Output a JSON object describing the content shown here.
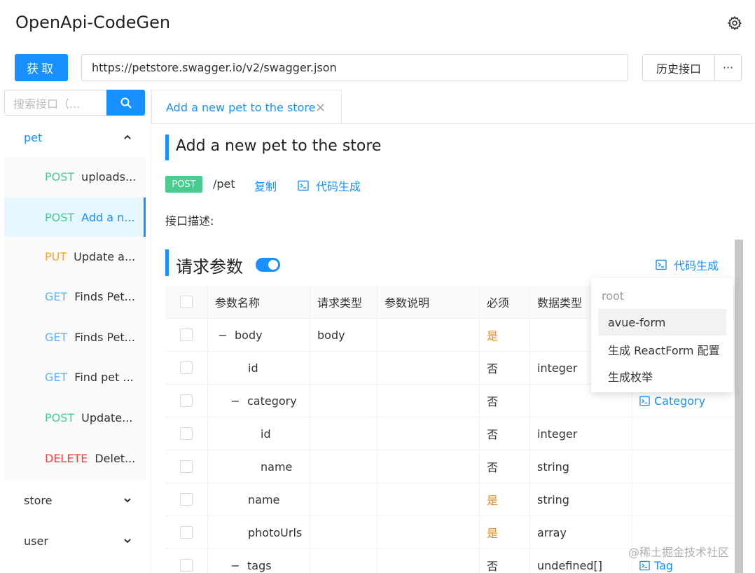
{
  "app": {
    "title": "OpenApi-CodeGen"
  },
  "toolbar": {
    "fetch_label": "获取",
    "url_value": "https://petstore.swagger.io/v2/swagger.json",
    "history_label": "历史接口",
    "more_label": "···"
  },
  "sidebar": {
    "search_placeholder": "搜索接口（...",
    "groups": [
      {
        "label": "pet",
        "expanded": true,
        "items": [
          {
            "method": "POST",
            "label": "uploads..."
          },
          {
            "method": "POST",
            "label": "Add a n...",
            "active": true
          },
          {
            "method": "PUT",
            "label": "Update a..."
          },
          {
            "method": "GET",
            "label": "Finds Pet..."
          },
          {
            "method": "GET",
            "label": "Finds Pet..."
          },
          {
            "method": "GET",
            "label": "Find pet ..."
          },
          {
            "method": "POST",
            "label": "Update..."
          },
          {
            "method": "DELETE",
            "label": "Delet..."
          }
        ]
      },
      {
        "label": "store",
        "expanded": false
      },
      {
        "label": "user",
        "expanded": false
      }
    ]
  },
  "tab": {
    "label": "Add a new pet to the store",
    "close": "×"
  },
  "operation": {
    "title": "Add a new pet to the store",
    "method": "POST",
    "path": "/pet",
    "copy_label": "复制",
    "codegen_label": "代码生成",
    "description_label": "接口描述:"
  },
  "params": {
    "section_title": "请求参数",
    "toggle_on": true,
    "codegen_label": "代码生成",
    "columns": [
      "参数名称",
      "请求类型",
      "参数说明",
      "必须",
      "数据类型"
    ],
    "rows": [
      {
        "name": "body",
        "in": "body",
        "desc": "",
        "required": "是",
        "type": "",
        "indent": 0,
        "expander": "−"
      },
      {
        "name": "id",
        "in": "",
        "desc": "",
        "required": "否",
        "type": "integer",
        "indent": 1
      },
      {
        "name": "category",
        "in": "",
        "desc": "",
        "required": "否",
        "type": "",
        "indent": 1,
        "expander": "−",
        "link": "Category"
      },
      {
        "name": "id",
        "in": "",
        "desc": "",
        "required": "否",
        "type": "integer",
        "indent": 2
      },
      {
        "name": "name",
        "in": "",
        "desc": "",
        "required": "否",
        "type": "string",
        "indent": 2
      },
      {
        "name": "name",
        "in": "",
        "desc": "",
        "required": "是",
        "type": "string",
        "indent": 1
      },
      {
        "name": "photoUrls",
        "in": "",
        "desc": "",
        "required": "是",
        "type": "array",
        "indent": 1
      },
      {
        "name": "tags",
        "in": "",
        "desc": "",
        "required": "否",
        "type": "undefined[]",
        "indent": 1,
        "expander": "−",
        "link": "Tag"
      }
    ]
  },
  "dropdown": {
    "group_label": "root",
    "items": [
      "avue-form",
      "生成 ReactForm 配置",
      "生成枚举"
    ]
  },
  "watermark": "@稀土掘金技术社区",
  "colors": {
    "primary": "#1890ff",
    "post": "#49cc90",
    "put": "#fca130",
    "get": "#61affe",
    "delete": "#f93e3e",
    "required": "#e88a1a"
  }
}
